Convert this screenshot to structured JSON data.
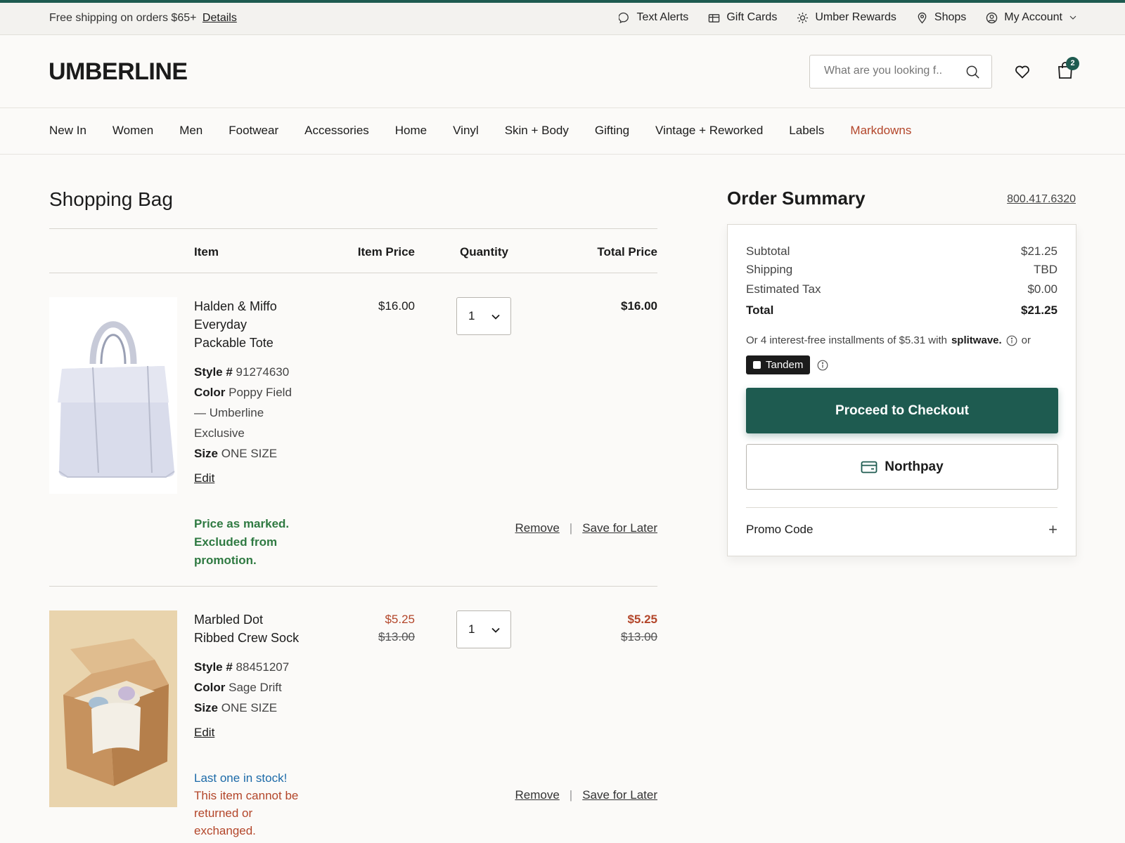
{
  "utility": {
    "promo_text": "Free shipping on orders $65+",
    "promo_link": "Details",
    "links": [
      {
        "label": "Text Alerts",
        "icon": "chat-bubble-icon"
      },
      {
        "label": "Gift Cards",
        "icon": "gift-card-icon"
      },
      {
        "label": "Umber Rewards",
        "icon": "sun-icon"
      },
      {
        "label": "Shops",
        "icon": "map-pin-icon"
      },
      {
        "label": "My Account",
        "icon": "user-circle-icon"
      }
    ]
  },
  "header": {
    "logo": "UMBERLINE",
    "search_placeholder": "What are you looking f..",
    "bag_count": "2"
  },
  "nav": {
    "items": [
      "New In",
      "Women",
      "Men",
      "Footwear",
      "Accessories",
      "Home",
      "Vinyl",
      "Skin + Body",
      "Gifting",
      "Vintage + Reworked",
      "Labels",
      "Markdowns"
    ]
  },
  "bag": {
    "title": "Shopping Bag",
    "columns": {
      "item": "Item",
      "item_price": "Item Price",
      "quantity": "Quantity",
      "total_price": "Total Price"
    },
    "items": [
      {
        "name": "Halden & Miffo Everyday Packable Tote",
        "style_label": "Style #",
        "style": "91274630",
        "color_label": "Color",
        "color": "Poppy Field — Umberline Exclusive",
        "size_label": "Size",
        "size": "ONE SIZE",
        "edit": "Edit",
        "note": "Price as marked. Excluded from promotion.",
        "price": "$16.00",
        "quantity": "1",
        "total": "$16.00",
        "remove": "Remove",
        "save_later": "Save for Later"
      },
      {
        "name": "Marbled Dot Ribbed Crew Sock",
        "style_label": "Style #",
        "style": "88451207",
        "color_label": "Color",
        "color": "Sage Drift",
        "size_label": "Size",
        "size": "ONE SIZE",
        "edit": "Edit",
        "note_stock": "Last one in stock!",
        "note_return": "This item cannot be returned or exchanged.",
        "price": "$5.25",
        "original_price": "$13.00",
        "quantity": "1",
        "total": "$5.25",
        "original_total": "$13.00",
        "remove": "Remove",
        "save_later": "Save for Later"
      }
    ]
  },
  "summary": {
    "title": "Order Summary",
    "phone": "800.417.6320",
    "subtotal_label": "Subtotal",
    "subtotal": "$21.25",
    "shipping_label": "Shipping",
    "shipping": "TBD",
    "tax_label": "Estimated Tax",
    "tax": "$0.00",
    "total_label": "Total",
    "total": "$21.25",
    "installments": "Or 4 interest-free installments of $5.31 with",
    "installments_brand": "splitwave.",
    "or": "or",
    "tandem": "Tandem",
    "checkout": "Proceed to Checkout",
    "northpay": "Northpay",
    "promo": "Promo Code"
  },
  "colors": {
    "accent": "#1e5b50",
    "sale": "#b3462a",
    "success": "#2f7a42",
    "info": "#1c6aa8"
  }
}
